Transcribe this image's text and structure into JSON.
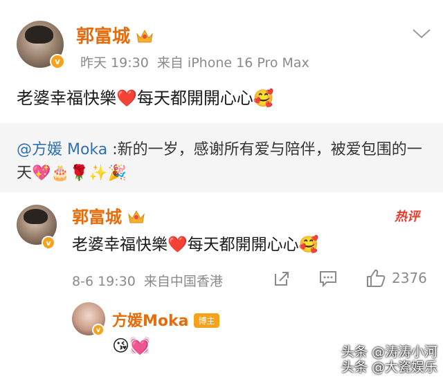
{
  "post": {
    "author": "郭富城",
    "time": "昨天 19:30",
    "source": "来自 iPhone 16 Pro Max",
    "text_before_heart": "老婆幸福快樂",
    "heart": "❤️",
    "text_after_heart": "每天都開開心心",
    "emoji_end": "🥰"
  },
  "repost": {
    "mention": "@方媛 Moka",
    "text": " :新的一岁，感谢所有爱与陪伴，被爱包围的一天💖🎂🌹✨🎉"
  },
  "comment": {
    "author": "郭富城",
    "hot_label": "热评",
    "text_before_heart": "老婆幸福快樂",
    "heart": "❤️",
    "text_after_heart": "每天都開開心心",
    "emoji_end": "🥰",
    "meta": "8-6 19:30  来自中国香港",
    "like_count": "2376"
  },
  "reply": {
    "author": "方媛Moka",
    "badge": "博主",
    "text": "😘💓"
  },
  "watermark": {
    "line1": "头条 @涛涛小河",
    "line2": "头条 @大瓷娱乐"
  },
  "colors": {
    "name": "#e86b0a",
    "mention": "#2f6fb3",
    "heart": "#e3142a",
    "repost_bg": "#f5f5f5",
    "meta": "#8a8a8a"
  },
  "icons": [
    "crown-icon",
    "chevron-down-icon",
    "verified-icon",
    "share-icon",
    "comment-icon",
    "like-icon",
    "hot-comment-icon"
  ]
}
